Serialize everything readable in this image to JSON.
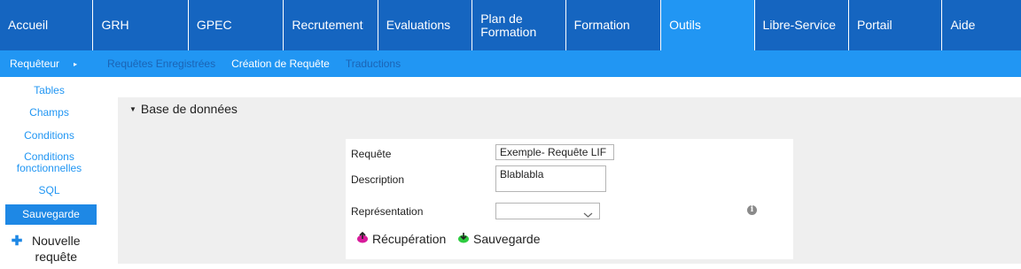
{
  "topnav": {
    "tabs": [
      {
        "label": "Accueil",
        "width": 106,
        "active": false
      },
      {
        "label": "GRH",
        "width": 108,
        "active": false
      },
      {
        "label": "GPEC",
        "width": 108,
        "active": false
      },
      {
        "label": "Recrutement",
        "width": 107,
        "active": false
      },
      {
        "label": "Evaluations",
        "width": 107,
        "active": false
      },
      {
        "label": "Plan de\nFormation",
        "width": 106,
        "active": false
      },
      {
        "label": "Formation",
        "width": 108,
        "active": false
      },
      {
        "label": "Outils",
        "width": 106,
        "active": true
      },
      {
        "label": "Libre-Service",
        "width": 107,
        "active": false
      },
      {
        "label": "Portail",
        "width": 106,
        "active": false
      },
      {
        "label": "Aide",
        "width": 89,
        "active": false
      }
    ]
  },
  "subnav": {
    "first_label": "Requêteur",
    "arrow": "▸",
    "items": [
      {
        "label": "Requêtes Enregistrées",
        "style": "muted"
      },
      {
        "label": "Création de Requête",
        "style": "bright"
      },
      {
        "label": "Traductions",
        "style": "muted"
      }
    ]
  },
  "leftmenu": {
    "items": {
      "tables": "Tables",
      "champs": "Champs",
      "conditions": "Conditions",
      "conditions_fonctionnelles": "Conditions fonctionnelles",
      "sql": "SQL",
      "sauvegarde": "Sauvegarde"
    },
    "new_query_plus": "✚",
    "new_query_label": "Nouvelle requête"
  },
  "main": {
    "section_caret": "▼",
    "section_title": "Base de données",
    "form": {
      "requete_label": "Requête",
      "requete_value": "Exemple- Requête LIF",
      "description_label": "Description",
      "description_value": "Blablabla",
      "representation_label": "Représentation",
      "representation_value": "",
      "info_glyph": "i",
      "recuperation_label": "Récupération",
      "sauvegarde_label": "Sauvegarde"
    }
  },
  "colors": {
    "topnav_bg": "#1565c0",
    "accent": "#2196f3",
    "active_tab": "#2196f3",
    "panel_bg": "#efefef",
    "recuperation_icon": "#d81b9b",
    "sauvegarde_icon": "#2ecc40"
  }
}
